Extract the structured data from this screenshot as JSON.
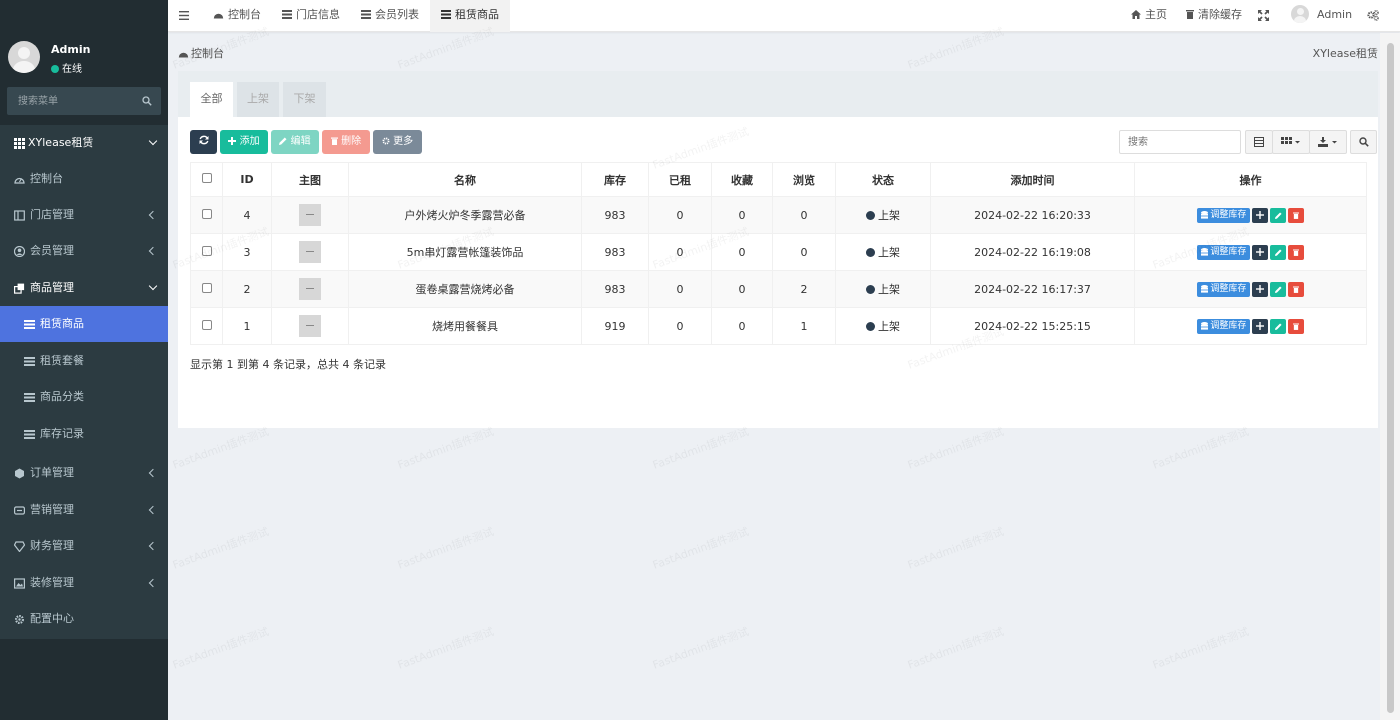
{
  "user": {
    "name": "Admin",
    "status": "在线"
  },
  "sidebar_search": {
    "placeholder": "搜索菜单"
  },
  "menu": {
    "group": "XYlease租赁",
    "items": [
      {
        "label": "控制台",
        "icon": "dashboard-icon"
      },
      {
        "label": "门店管理",
        "icon": "store-icon"
      },
      {
        "label": "会员管理",
        "icon": "user-icon"
      },
      {
        "label": "商品管理",
        "icon": "product-icon"
      },
      {
        "label": "租赁商品",
        "icon": "list-icon"
      },
      {
        "label": "租赁套餐",
        "icon": "list-icon"
      },
      {
        "label": "商品分类",
        "icon": "list-icon"
      },
      {
        "label": "库存记录",
        "icon": "list-icon"
      },
      {
        "label": "订单管理",
        "icon": "order-icon"
      },
      {
        "label": "营销管理",
        "icon": "marketing-icon"
      },
      {
        "label": "财务管理",
        "icon": "finance-icon"
      },
      {
        "label": "装修管理",
        "icon": "decor-icon"
      },
      {
        "label": "配置中心",
        "icon": "gear-icon"
      }
    ]
  },
  "topnav": {
    "tabs": [
      "控制台",
      "门店信息",
      "会员列表",
      "租赁商品"
    ],
    "home": "主页",
    "clear_cache": "清除缓存",
    "admin": "Admin"
  },
  "breadcrumb": {
    "current": "控制台",
    "right": "XYlease租赁"
  },
  "panel_tabs": [
    "全部",
    "上架",
    "下架"
  ],
  "toolbar": {
    "add": "添加",
    "edit": "编辑",
    "delete": "删除",
    "more": "更多",
    "search_placeholder": "搜索"
  },
  "table": {
    "headers": [
      "ID",
      "主图",
      "名称",
      "库存",
      "已租",
      "收藏",
      "浏览",
      "状态",
      "添加时间",
      "操作"
    ],
    "rows": [
      {
        "id": "4",
        "name": "户外烤火炉冬季露营必备",
        "stock": "983",
        "rented": "0",
        "fav": "0",
        "views": "0",
        "status": "上架",
        "time": "2024-02-22 16:20:33"
      },
      {
        "id": "3",
        "name": "5m串灯露营帐篷装饰品",
        "stock": "983",
        "rented": "0",
        "fav": "0",
        "views": "0",
        "status": "上架",
        "time": "2024-02-22 16:19:08"
      },
      {
        "id": "2",
        "name": "蛋卷桌露营烧烤必备",
        "stock": "983",
        "rented": "0",
        "fav": "0",
        "views": "2",
        "status": "上架",
        "time": "2024-02-22 16:17:37"
      },
      {
        "id": "1",
        "name": "烧烤用餐餐具",
        "stock": "919",
        "rented": "0",
        "fav": "0",
        "views": "1",
        "status": "上架",
        "time": "2024-02-22 15:25:15"
      }
    ],
    "adjust_stock": "调整库存"
  },
  "summary": "显示第 1 到第 4 条记录，总共 4 条记录",
  "watermark": "FastAdmin插件测试",
  "colors": {
    "sidebar": "#222d32",
    "active": "#4e73df",
    "primary": "#18bc9c",
    "danger": "#e74c3c",
    "dark": "#2c3e50"
  }
}
